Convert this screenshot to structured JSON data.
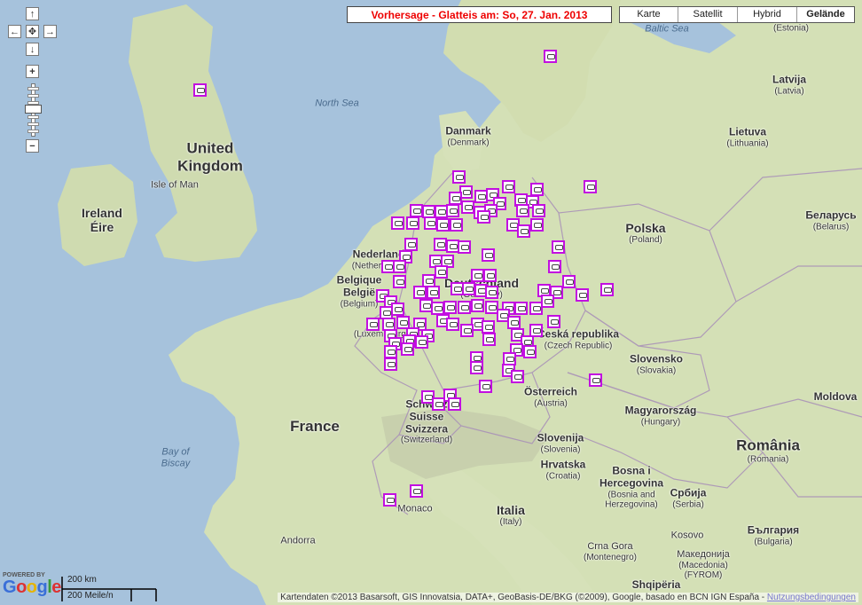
{
  "banner": {
    "text": "Vorhersage - Glatteis am: So, 27. Jan. 2013"
  },
  "map_types": [
    {
      "label": "Karte",
      "active": false
    },
    {
      "label": "Satellit",
      "active": false
    },
    {
      "label": "Hybrid",
      "active": false
    },
    {
      "label": "Gelände",
      "active": true
    }
  ],
  "nav_controls": {
    "up": "↑",
    "left": "←",
    "center": "✥",
    "right": "→",
    "down": "↓",
    "zoom_in": "+",
    "zoom_out": "−"
  },
  "labels": {
    "united_kingdom_1": "United",
    "united_kingdom_2": "Kingdom",
    "isle_of_man": "Isle of Man",
    "ireland_1": "Ireland",
    "ireland_2": "Éire",
    "north_sea": "North Sea",
    "baltic_sea": "Baltic Sea",
    "denmark": "Danmark",
    "denmark_sub": "(Denmark)",
    "estonia_sub": "(Estonia)",
    "latvia": "Latvija",
    "latvia_sub": "(Latvia)",
    "lithuania": "Lietuva",
    "lithuania_sub": "(Lithuania)",
    "polska": "Polska",
    "polska_sub": "(Poland)",
    "belarus": "Беларусь",
    "belarus_sub": "(Belarus)",
    "netherlands": "Nederland",
    "netherlands_sub": "(Netherlands)",
    "belgium": "België",
    "belgium_pre": "Belgique",
    "belgium_sub": "(Belgium)",
    "luxembourg": "(Luxembourg)",
    "deutschland": "Deutschland",
    "deutschland_sub": "(Germany)",
    "czech": "Česká republika",
    "czech_sub": "(Czech Republic)",
    "slovakia": "Slovensko",
    "slovakia_sub": "(Slovakia)",
    "austria": "Österreich",
    "austria_sub": "(Austria)",
    "hungary": "Magyarország",
    "hungary_sub": "(Hungary)",
    "moldova": "Moldova",
    "romania": "România",
    "romania_sub": "(Romania)",
    "switzerland_1": "Schweiz",
    "switzerland_2": "Suisse",
    "switzerland_3": "Svizzera",
    "switzerland_sub": "(Switzerland)",
    "france": "France",
    "bay_of_biscay_1": "Bay of",
    "bay_of_biscay_2": "Biscay",
    "slovenia": "Slovenija",
    "slovenia_sub": "(Slovenia)",
    "croatia": "Hrvatska",
    "croatia_sub": "(Croatia)",
    "bosnia_1": "Bosna i",
    "bosnia_2": "Hercegovina",
    "bosnia_sub_1": "(Bosnia and",
    "bosnia_sub_2": "Herzegovina)",
    "serbia": "Србија",
    "serbia_sub": "(Serbia)",
    "monaco": "Monaco",
    "italia": "Italia",
    "italia_sub": "(Italy)",
    "andorra": "Andorra",
    "montenegro": "Crna Gora",
    "montenegro_sub": "(Montenegro)",
    "kosovo": "Kosovo",
    "macedonia": "Македонија",
    "macedonia_sub": "(Macedonia)",
    "macedonia_sub2": "(FYROM)",
    "bulgaria": "България",
    "bulgaria_sub": "(Bulgaria)",
    "albania": "Shqipëria"
  },
  "logo": {
    "powered": "POWERED BY",
    "google": "Google"
  },
  "scale": {
    "km": "200 km",
    "miles": "200 Meile/n"
  },
  "credits": {
    "text": "Kartendaten ©2013 Basarsoft, GIS Innovatsia, DATA+, GeoBasis-DE/BKG (©2009), Google, basado en BCN IGN España - ",
    "link": "Nutzungsbedingungen"
  },
  "colors": {
    "marker": "#c20fe0",
    "banner_text": "#e00000",
    "sea": "#a6c2dc",
    "land": "#d8e3bf"
  }
}
